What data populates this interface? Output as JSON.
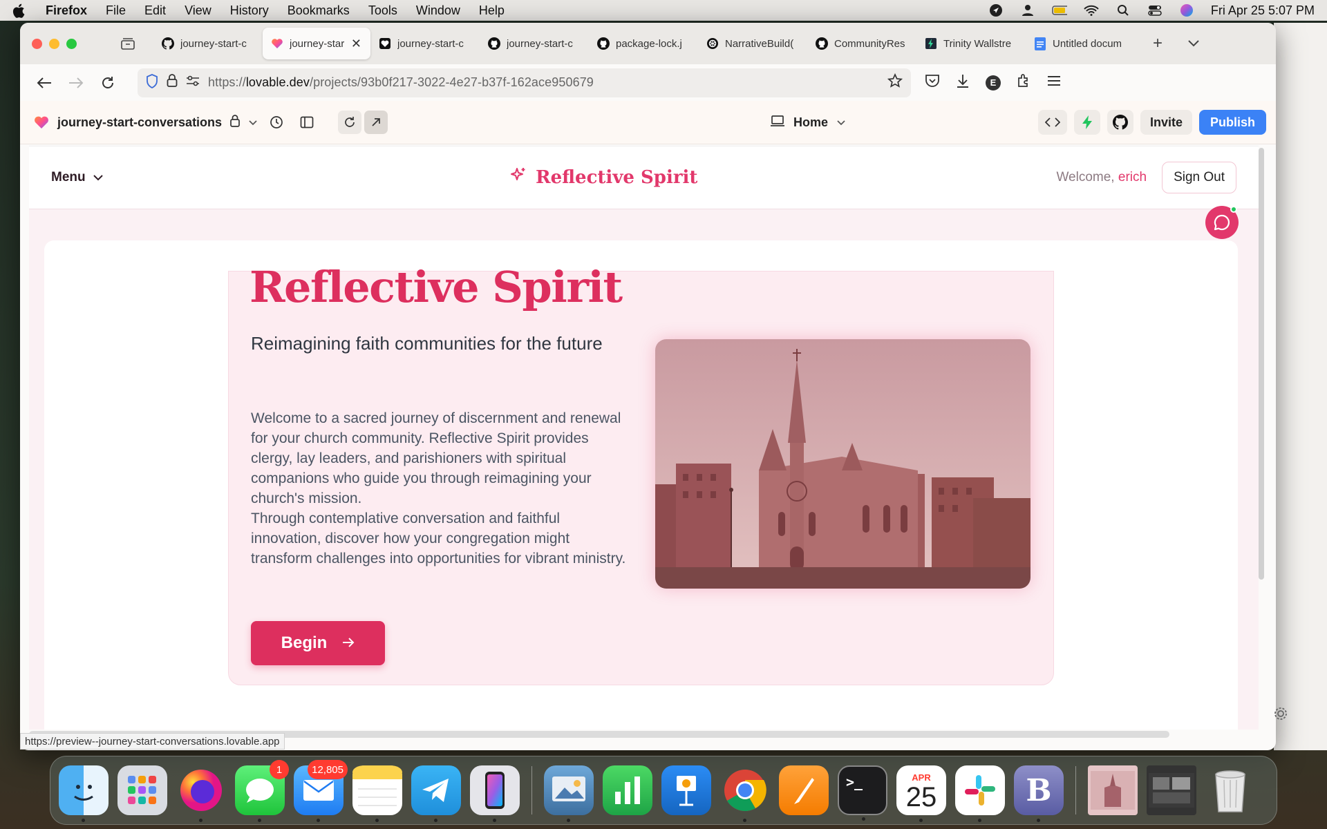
{
  "menubar": {
    "app": "Firefox",
    "items": [
      "File",
      "Edit",
      "View",
      "History",
      "Bookmarks",
      "Tools",
      "Window",
      "Help"
    ],
    "datetime": "Fri Apr 25  5:07 PM"
  },
  "tabs": [
    {
      "label": "journey-start-c",
      "icon": "github-icon"
    },
    {
      "label": "journey-star",
      "icon": "lovable-icon",
      "active": true
    },
    {
      "label": "journey-start-c",
      "icon": "heart-icon"
    },
    {
      "label": "journey-start-c",
      "icon": "github-icon"
    },
    {
      "label": "package-lock.j",
      "icon": "github-icon"
    },
    {
      "label": "NarrativeBuild(",
      "icon": "openai-icon"
    },
    {
      "label": "CommunityRes",
      "icon": "github-icon"
    },
    {
      "label": "Trinity Wallstre",
      "icon": "bolt-icon"
    },
    {
      "label": "Untitled docum",
      "icon": "docs-icon"
    }
  ],
  "navbar": {
    "url_host": "https://",
    "url_domain": "lovable.dev",
    "url_path": "/projects/93b0f217-3022-4e27-b37f-162ace950679",
    "profile_letter": "E"
  },
  "lovable": {
    "project_name": "journey-start-conversations",
    "page_selector": "Home",
    "invite_label": "Invite",
    "publish_label": "Publish"
  },
  "site": {
    "menu_label": "Menu",
    "brand": "Reflective Spirit",
    "welcome_prefix": "Welcome, ",
    "username": "erich",
    "signout_label": "Sign Out",
    "hero_title": "Reflective Spirit",
    "hero_subtitle": "Reimagining faith communities for the future",
    "hero_p1": "Welcome to a sacred journey of discernment and renewal for your church community. Reflective Spirit provides clergy, lay leaders, and parishioners with spiritual companions who guide you through reimagining your church's mission.",
    "hero_p2": "Through contemplative conversation and faithful innovation, discover how your congregation might transform challenges into opportunities for vibrant ministry.",
    "begin_label": "Begin"
  },
  "status_url": "https://preview--journey-start-conversations.lovable.app",
  "dock": {
    "messages_badge": "1",
    "mail_badge": "12,805",
    "calendar_month": "APR",
    "calendar_day": "25"
  },
  "colors": {
    "accent": "#dd2f5e",
    "publish": "#3b82f6",
    "card_bg": "#fdecf1"
  }
}
